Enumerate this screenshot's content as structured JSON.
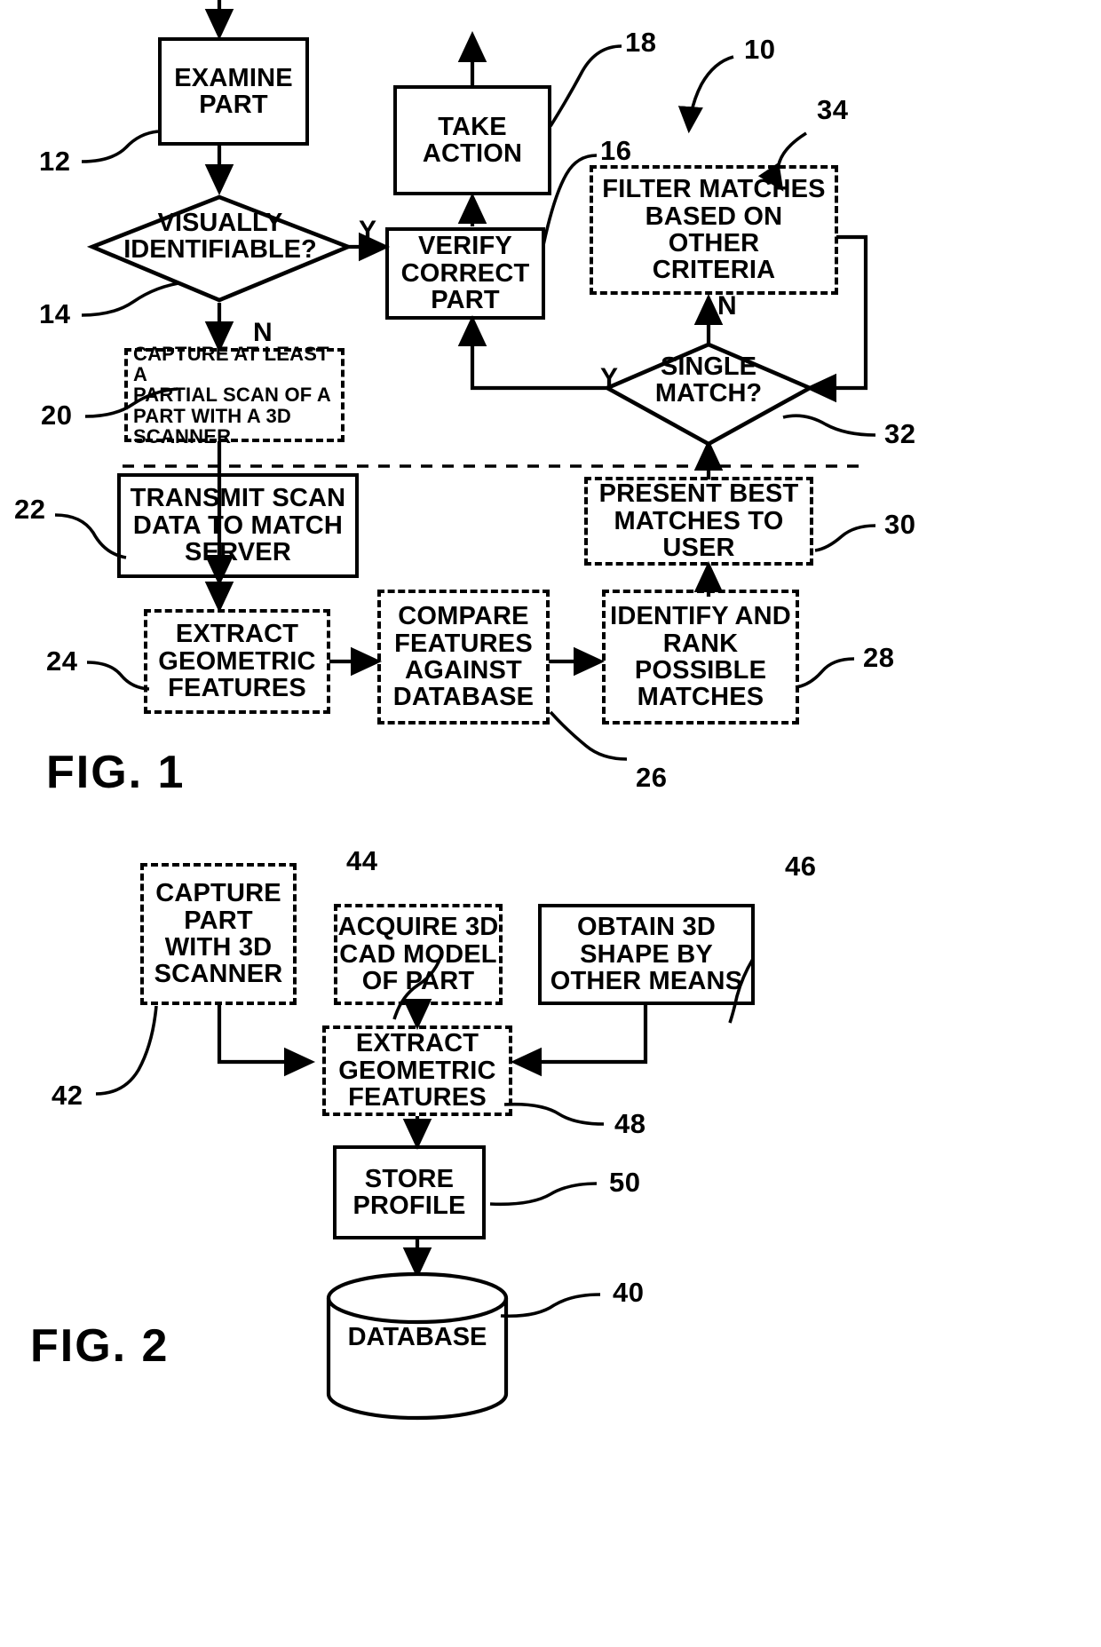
{
  "figures": [
    {
      "caption": "FIG. 1",
      "ref_overall": "10"
    },
    {
      "caption": "FIG. 2",
      "ref_overall": "40"
    }
  ],
  "fig1": {
    "caption": "FIG. 1",
    "nodes": {
      "examine_part": {
        "text": "EXAMINE\nPART",
        "ref": "12",
        "style": "solid"
      },
      "visually_identifiable": {
        "text": "VISUALLY\nIDENTIFIABLE?",
        "ref": "14",
        "style": "diamond"
      },
      "verify_correct_part": {
        "text": "VERIFY\nCORRECT\nPART",
        "ref": "16",
        "style": "solid"
      },
      "take_action": {
        "text": "TAKE\nACTION",
        "ref": "18",
        "style": "solid"
      },
      "capture_scan": {
        "text": "CAPTURE AT LEAST A\nPARTIAL SCAN OF A\nPART WITH A 3D\nSCANNER",
        "ref": "20",
        "style": "dashed"
      },
      "transmit_scan": {
        "text": "TRANSMIT SCAN\nDATA TO MATCH\nSERVER",
        "ref": "22",
        "style": "solid"
      },
      "extract_features": {
        "text": "EXTRACT\nGEOMETRIC\nFEATURES",
        "ref": "24",
        "style": "dashed"
      },
      "compare_features": {
        "text": "COMPARE\nFEATURES\nAGAINST\nDATABASE",
        "ref": "26",
        "style": "dashed"
      },
      "identify_rank": {
        "text": "IDENTIFY AND\nRANK\nPOSSIBLE\nMATCHES",
        "ref": "28",
        "style": "dashed"
      },
      "present_best": {
        "text": "PRESENT BEST\nMATCHES TO\nUSER",
        "ref": "30",
        "style": "dashed"
      },
      "single_match": {
        "text": "SINGLE\nMATCH?",
        "ref": "32",
        "style": "diamond"
      },
      "filter_matches": {
        "text": "FILTER MATCHES\nBASED ON\nOTHER\nCRITERIA",
        "ref": "34",
        "style": "dashed"
      }
    },
    "edge_labels": {
      "visually_yes": "Y",
      "visually_no": "N",
      "single_yes": "Y",
      "single_no": "N"
    },
    "refs": [
      "10",
      "12",
      "14",
      "16",
      "18",
      "20",
      "22",
      "24",
      "26",
      "28",
      "30",
      "32",
      "34"
    ]
  },
  "fig2": {
    "caption": "FIG. 2",
    "nodes": {
      "capture_part": {
        "text": "CAPTURE\nPART\nWITH 3D\nSCANNER",
        "ref": "42",
        "style": "dashed"
      },
      "acquire_cad": {
        "text": "ACQUIRE 3D\nCAD MODEL\nOF PART",
        "ref": "44",
        "style": "dashed"
      },
      "obtain_shape": {
        "text": "OBTAIN 3D\nSHAPE BY\nOTHER MEANS",
        "ref": "46",
        "style": "solid"
      },
      "extract_features": {
        "text": "EXTRACT\nGEOMETRIC\nFEATURES",
        "ref": "48",
        "style": "dashed"
      },
      "store_profile": {
        "text": "STORE\nPROFILE",
        "ref": "50",
        "style": "solid"
      },
      "database": {
        "text": "DATABASE",
        "ref": "40",
        "style": "cylinder"
      }
    },
    "refs": [
      "40",
      "42",
      "44",
      "46",
      "48",
      "50"
    ]
  },
  "colors": {
    "ink": "#000000",
    "paper": "#ffffff"
  }
}
